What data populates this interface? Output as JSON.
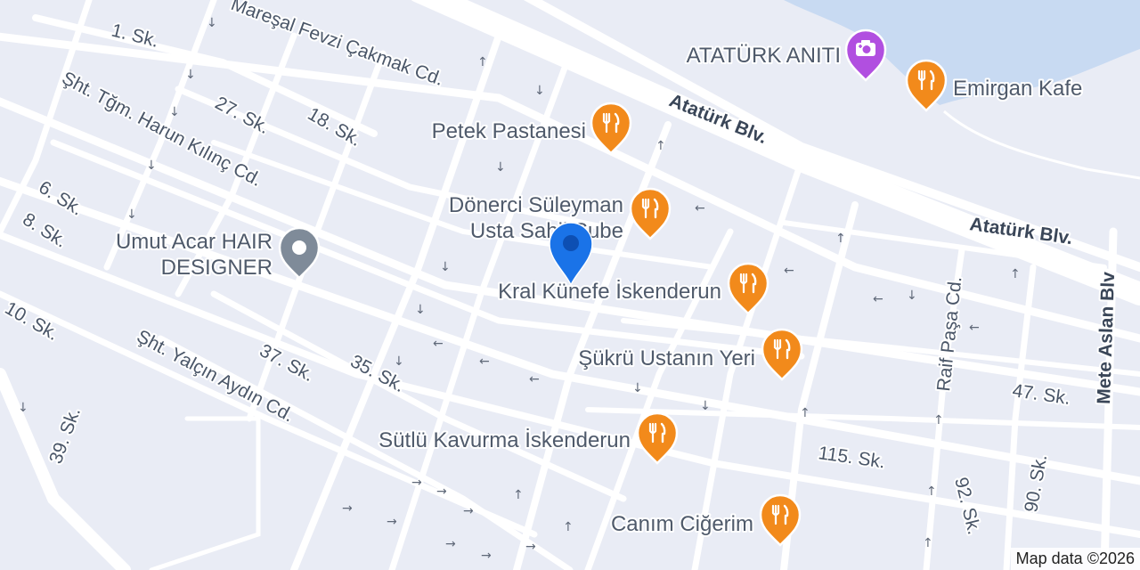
{
  "colors": {
    "background": "#e9ecf5",
    "water": "#c8daf2",
    "road": "#ffffff",
    "restaurant": "#f28a1b",
    "landmark": "#b14fe0",
    "business": "#7f8b99",
    "location_pin": "#1a73e8",
    "arrow": "#5f6878"
  },
  "streets": [
    {
      "id": "1-sk",
      "name": "1. Sk."
    },
    {
      "id": "maresal",
      "name": "Mareşal Fevzi Çakmak Cd."
    },
    {
      "id": "ataturk-1",
      "name": "Atatürk Blv."
    },
    {
      "id": "ataturk-2",
      "name": "Atatürk Blv."
    },
    {
      "id": "sht-tgm",
      "name": "Şht. Tğm. Harun Kılınç Cd."
    },
    {
      "id": "27-sk",
      "name": "27. Sk."
    },
    {
      "id": "18-sk",
      "name": "18. Sk."
    },
    {
      "id": "6-sk",
      "name": "6. Sk."
    },
    {
      "id": "8-sk",
      "name": "8. Sk."
    },
    {
      "id": "10-sk",
      "name": "10. Sk."
    },
    {
      "id": "39-sk",
      "name": "39. Sk."
    },
    {
      "id": "sht-yalcin",
      "name": "Şht. Yalçın Aydın Cd."
    },
    {
      "id": "37-sk",
      "name": "37. Sk."
    },
    {
      "id": "35-sk",
      "name": "35. Sk."
    },
    {
      "id": "115-sk",
      "name": "115. Sk."
    },
    {
      "id": "47-sk",
      "name": "47. Sk."
    },
    {
      "id": "raif",
      "name": "Raif Paşa Cd."
    },
    {
      "id": "mete",
      "name": "Mete Aslan Blv"
    },
    {
      "id": "92-sk",
      "name": "92. Sk."
    },
    {
      "id": "90-sk",
      "name": "90. Sk."
    }
  ],
  "pois": [
    {
      "id": "ataturk-aniti",
      "name": "ATATÜRK ANITI",
      "category": "landmark",
      "icon": "camera-icon"
    },
    {
      "id": "emirgan",
      "name": "Emirgan Kafe",
      "category": "restaurant",
      "icon": "fork-knife-icon"
    },
    {
      "id": "petek",
      "name": "Petek Pastanesi",
      "category": "restaurant",
      "icon": "fork-knife-icon"
    },
    {
      "id": "donerci",
      "name": "Dönerci Süleyman Usta Sahil Şube",
      "line1": "Dönerci Süleyman",
      "line2": "Usta Sahil Şube",
      "category": "restaurant",
      "icon": "fork-knife-icon"
    },
    {
      "id": "umut",
      "name": "Umut Acar HAIR DESIGNER",
      "line1": "Umut Acar HAIR",
      "line2": "DESIGNER",
      "category": "business",
      "icon": "dot-icon"
    },
    {
      "id": "kral",
      "name": "Kral Künefe İskenderun",
      "category": "restaurant",
      "icon": "fork-knife-icon"
    },
    {
      "id": "sukru",
      "name": "Şükrü Ustanın Yeri",
      "category": "restaurant",
      "icon": "fork-knife-icon"
    },
    {
      "id": "sutlu",
      "name": "Sütlü Kavurma İskenderun",
      "category": "restaurant",
      "icon": "fork-knife-icon"
    },
    {
      "id": "canim",
      "name": "Canım Ciğerim",
      "category": "restaurant",
      "icon": "fork-knife-icon"
    }
  ],
  "attribution": "Map data ©2026"
}
